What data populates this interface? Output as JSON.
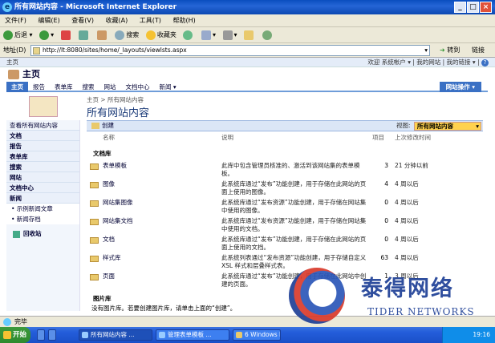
{
  "window": {
    "title": "所有网站内容 - Microsoft Internet Explorer",
    "controls": [
      "_",
      "□",
      "×"
    ]
  },
  "menu": [
    "文件(F)",
    "编辑(E)",
    "查看(V)",
    "收藏(A)",
    "工具(T)",
    "帮助(H)"
  ],
  "toolbar": {
    "back": "后退",
    "search": "搜索",
    "favorites": "收藏夹"
  },
  "address": {
    "label": "地址(D)",
    "url": "http://lt:8080/sites/home/_layouts/viewlsts.aspx",
    "go": "转到",
    "links": "链接"
  },
  "sharepoint": {
    "top_left": "主页",
    "top_right": "欢迎 系统帐户 ▾ | 我的网站 | 我的链接 ▾ |",
    "site_title": "主页",
    "tabs": [
      "主页",
      "报告",
      "表单库",
      "搜索",
      "网站",
      "文档中心",
      "新闻 ▾"
    ],
    "site_actions": "网站操作 ▾",
    "breadcrumb": "主页 > 所有网站内容",
    "page_title": "所有网站内容",
    "quick_launch": [
      {
        "label": "查看所有网站内容",
        "type": "link"
      },
      {
        "label": "文档",
        "type": "head"
      },
      {
        "label": "报告",
        "type": "head"
      },
      {
        "label": "表单库",
        "type": "head"
      },
      {
        "label": "搜索",
        "type": "head"
      },
      {
        "label": "网站",
        "type": "head"
      },
      {
        "label": "文档中心",
        "type": "head"
      },
      {
        "label": "新闻",
        "type": "head"
      },
      {
        "label": "• 示例新闻文章",
        "type": "sub"
      },
      {
        "label": "• 新闻存档",
        "type": "sub"
      }
    ],
    "recycle_bin": "回收站",
    "create": "创建",
    "view_label": "视图:",
    "view_value": "所有网站内容",
    "columns": {
      "name": "名称",
      "description": "说明",
      "items": "项目",
      "modified": "上次修改时间"
    },
    "library_section": "文档库",
    "libraries": [
      {
        "name": "表单模板",
        "desc": "此库中包含管理员核准的、激活到该网站集的表单模板。",
        "count": "3",
        "modified": "21 分钟以前"
      },
      {
        "name": "图像",
        "desc": "此系统库通过“发布”功能创建，用于存储在此网站的页面上使用的图像。",
        "count": "4",
        "modified": "4 周以后"
      },
      {
        "name": "网站集图像",
        "desc": "此系统库通过“发布资源”功能创建，用于存储在网站集中使用的图像。",
        "count": "0",
        "modified": "4 周以后"
      },
      {
        "name": "网站集文档",
        "desc": "此系统库通过“发布资源”功能创建，用于存储在网站集中使用的文档。",
        "count": "0",
        "modified": "4 周以后"
      },
      {
        "name": "文档",
        "desc": "此系统库通过“发布”功能创建，用于存储在此网站的页面上使用的文档。",
        "count": "0",
        "modified": "4 周以后"
      },
      {
        "name": "样式库",
        "desc": "此系统列表通过“发布资源”功能创建，用于存储自定义 XSL 样式和层叠样式表。",
        "count": "63",
        "modified": "4 周以后"
      },
      {
        "name": "页面",
        "desc": "此系统库通过“发布”功能创建，用于存储在此网站中创建的页面。",
        "count": "1",
        "modified": "3 周以后"
      }
    ],
    "picture_section": "图片库",
    "picture_note": "没有图片库。若要创建图片库，请单击上面的“创建”。"
  },
  "status": "完毕",
  "taskbar": {
    "start": "开始",
    "tasks": [
      "所有网站内容 ...",
      "管理表单模板 ...",
      "6 Windows Ex..."
    ],
    "clock": "19:16"
  },
  "watermark": {
    "chinese": "泰得网络",
    "english": "TIDER NETWORKS"
  }
}
